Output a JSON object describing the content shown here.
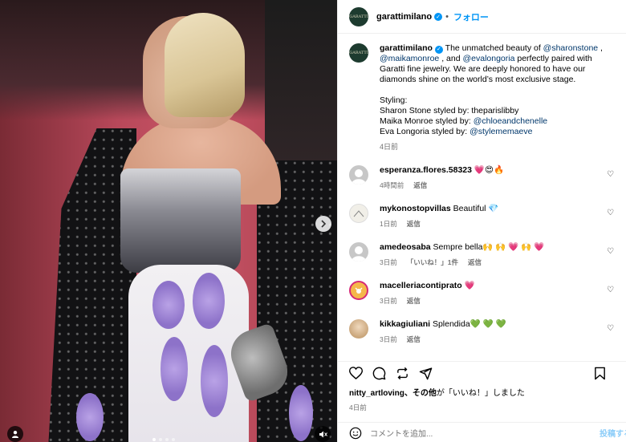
{
  "post": {
    "author": "garattimilano",
    "avatar_text": "GARATTI",
    "follow_label": "フォロー",
    "dot": "•",
    "caption": {
      "t1": "The unmatched beauty of ",
      "m1": "@sharonstone",
      "t2": " ,",
      "m2": "@maikamonroe",
      "t3": " , and ",
      "m3": "@evalongoria",
      "t4": " perfectly paired with Garatti fine jewelry. We are deeply honored to have our diamonds shine on the world’s most exclusive stage.",
      "styling_label": "Styling:",
      "line1": "Sharon Stone styled by: theparislibby",
      "line2_prefix": "Maika Monroe styled by: ",
      "line2_mention": "@chloeandchenelle",
      "line3_prefix": "Eva Longoria styled by: ",
      "line3_mention": "@stylememaeve"
    },
    "time": "4日前"
  },
  "comments": [
    {
      "user": "esperanza.flores.58323",
      "text": "💗😍🔥",
      "time": "4時間前",
      "reply": "返信",
      "likes": "",
      "avatar_color": "#c7c7c7"
    },
    {
      "user": "mykonostopvillas",
      "text": "Beautiful 💎",
      "time": "1日前",
      "reply": "返信",
      "likes": "",
      "avatar_color": "#e9e4d4"
    },
    {
      "user": "amedeosaba",
      "text": "Sempre bella🙌 🙌 💗 🙌 💗",
      "time": "3日前",
      "reply": "返信",
      "likes": "「いいね！」1件",
      "avatar_color": "#c7c7c7"
    },
    {
      "user": "macelleriacontiprato",
      "text": "💗",
      "time": "3日前",
      "reply": "返信",
      "likes": "",
      "avatar_color": "#f5b74a"
    },
    {
      "user": "kikkagiuliani",
      "text": "Splendida💚 💚 💚",
      "time": "3日前",
      "reply": "返信",
      "likes": "",
      "avatar_color": "#d9c6a8"
    }
  ],
  "likes": {
    "user": "nitty_artloving",
    "suffix_bold": "、その他",
    "suffix": "が「いいね！」しました"
  },
  "post_age": "4日前",
  "add_comment_placeholder": "コメントを追加...",
  "post_button": "投稿する",
  "colors": {
    "link": "#00376b",
    "accent": "#0095f6"
  }
}
